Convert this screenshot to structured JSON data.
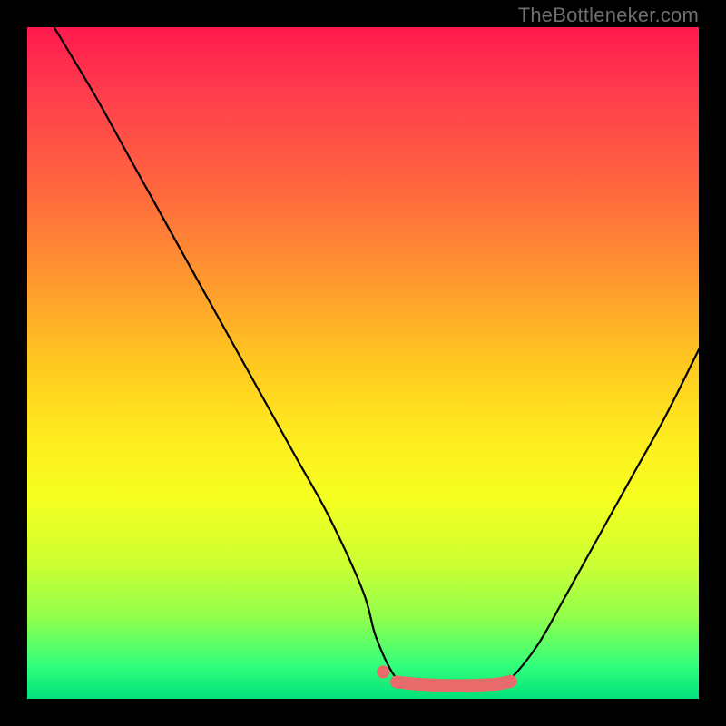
{
  "watermark": "TheBottleneker.com",
  "chart_data": {
    "type": "line",
    "title": "",
    "xlabel": "",
    "ylabel": "",
    "xlim": [
      0,
      100
    ],
    "ylim": [
      0,
      100
    ],
    "grid": false,
    "legend": false,
    "series": [
      {
        "name": "bottleneck-curve",
        "color": "#000000",
        "x": [
          4,
          10,
          15,
          20,
          25,
          30,
          35,
          40,
          45,
          50,
          52,
          55,
          58,
          62,
          66,
          70,
          72,
          76,
          80,
          85,
          90,
          95,
          100
        ],
        "y": [
          100,
          90,
          81,
          72,
          63,
          54,
          45,
          36,
          27,
          16,
          9,
          3,
          2,
          2,
          2,
          2,
          3,
          8,
          15,
          24,
          33,
          42,
          52
        ]
      }
    ],
    "markers": [
      {
        "name": "target-band",
        "color": "#e86a6a",
        "x": [
          55,
          58,
          62,
          66,
          70,
          72
        ],
        "y": [
          2.5,
          2.2,
          2.0,
          2.0,
          2.2,
          2.6
        ]
      },
      {
        "name": "target-point",
        "color": "#e86a6a",
        "x": 53,
        "y": 4
      }
    ]
  }
}
